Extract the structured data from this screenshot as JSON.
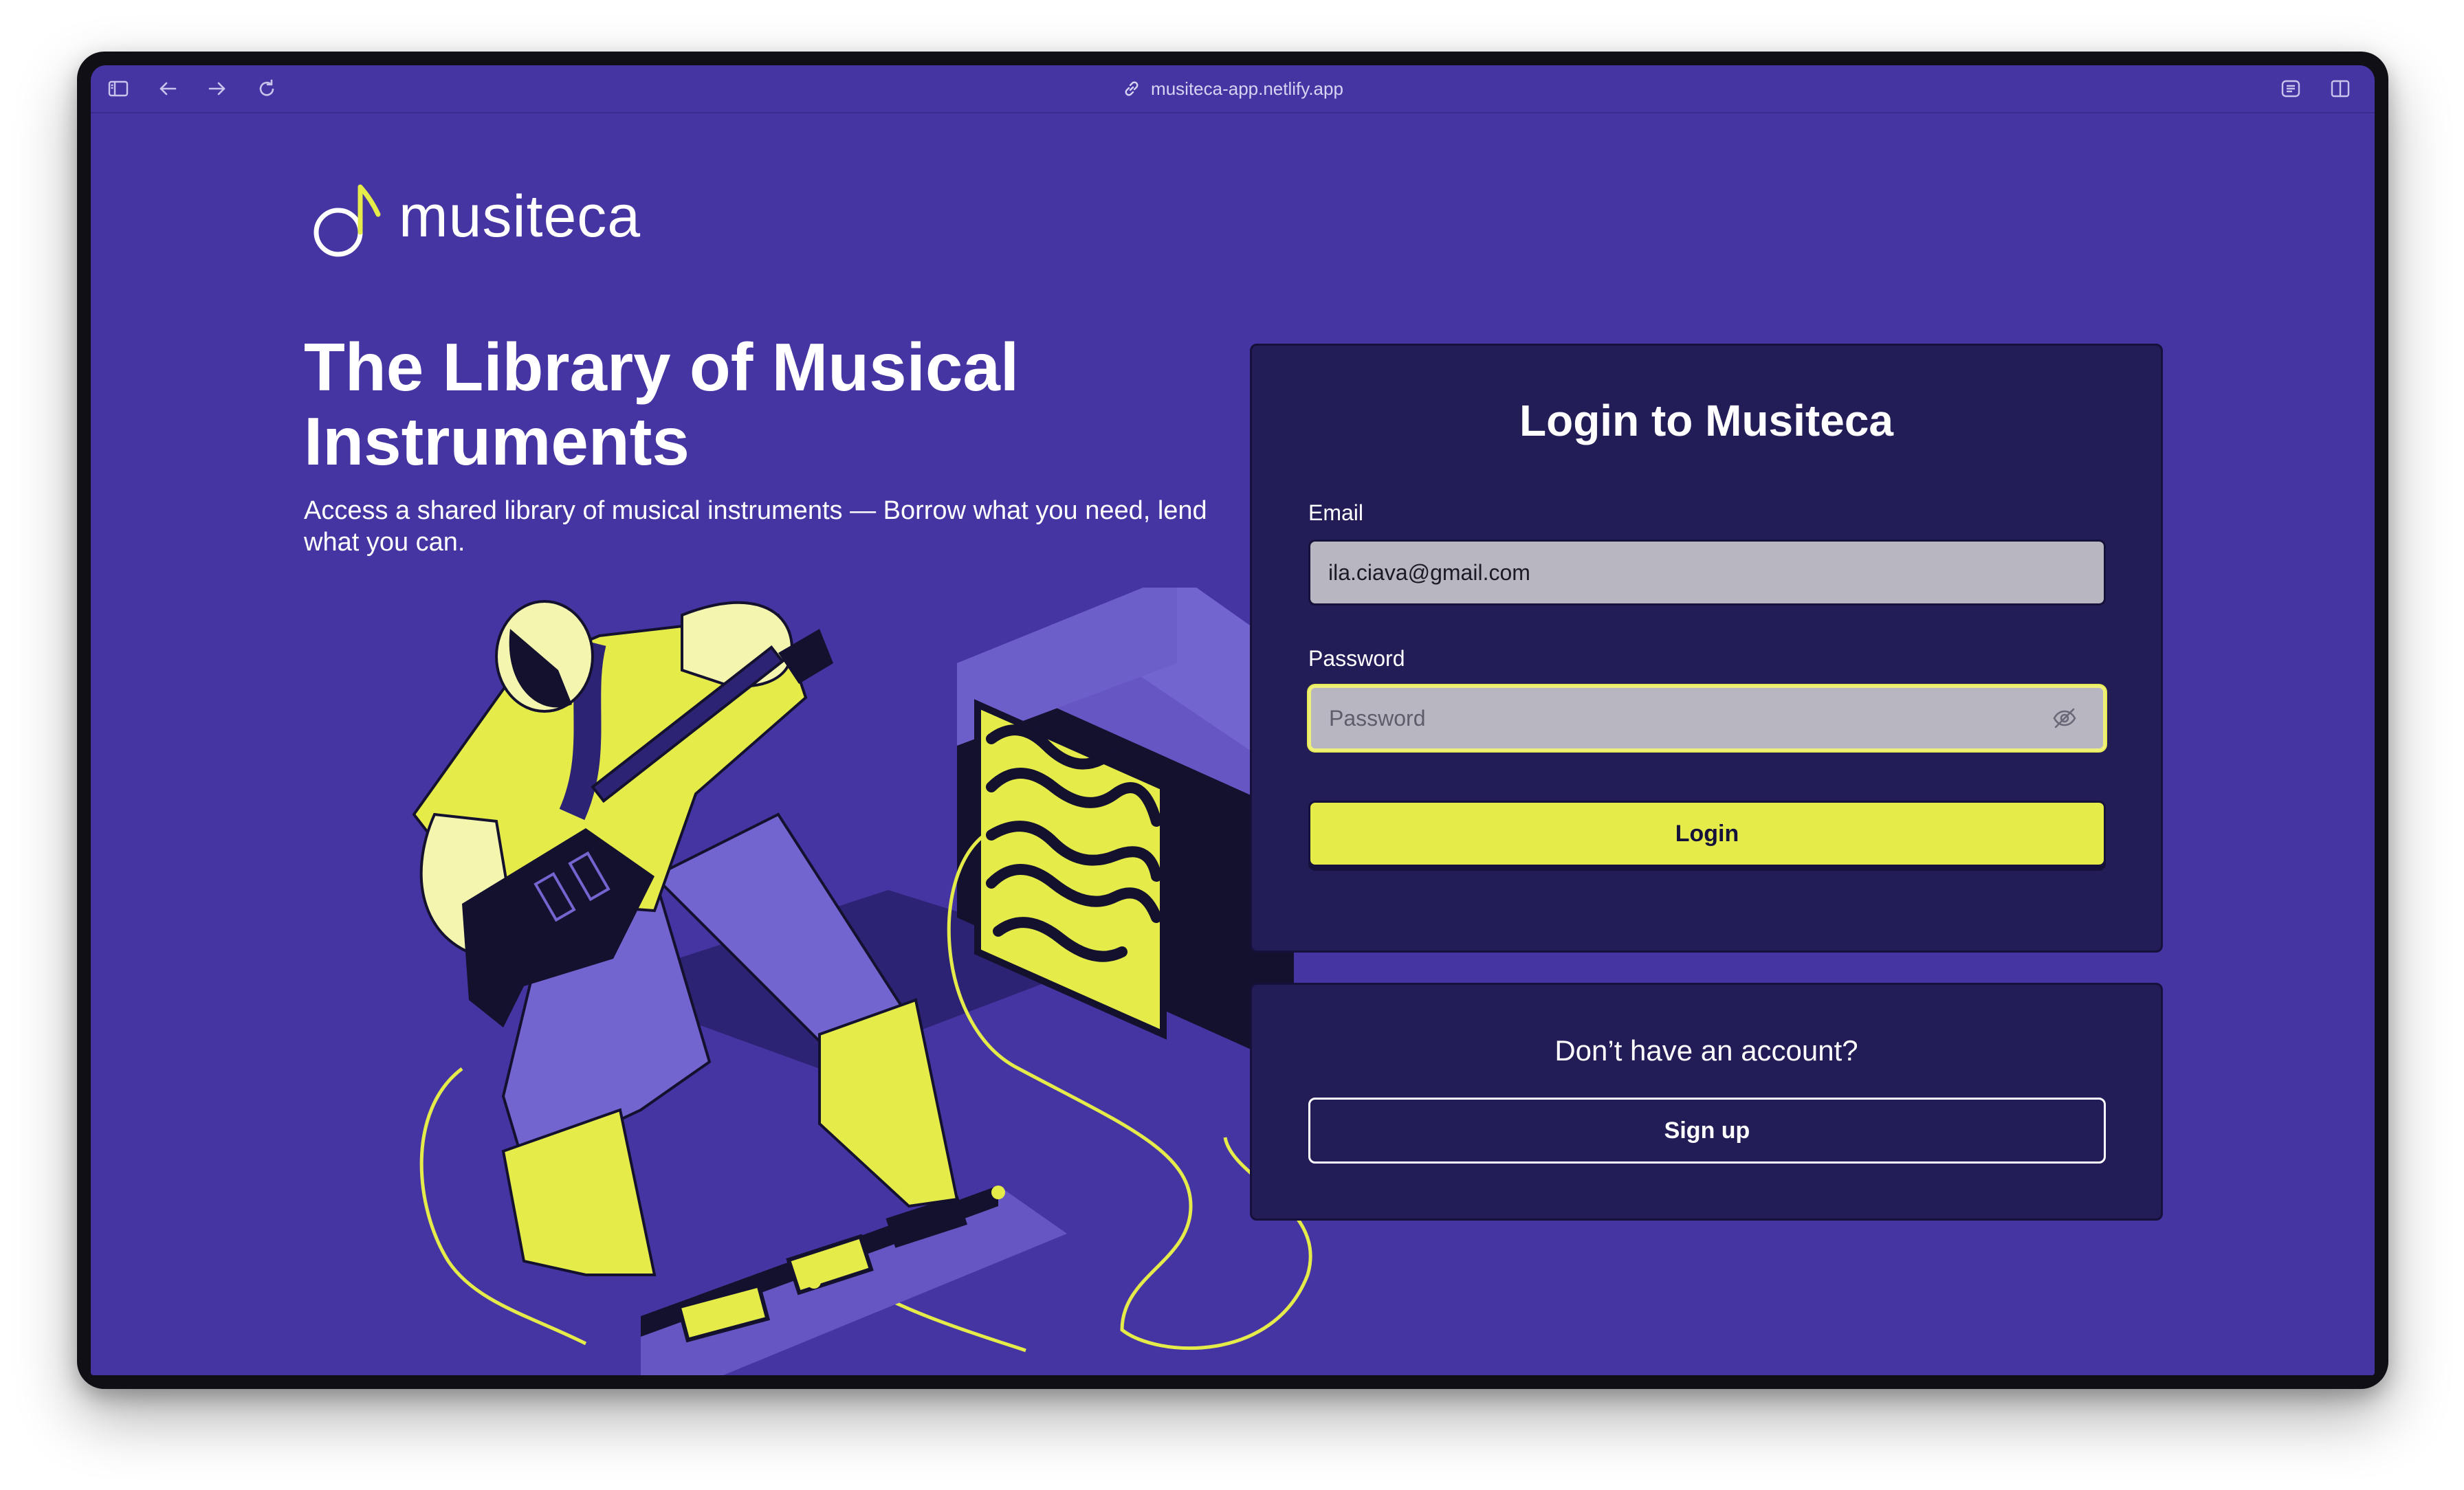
{
  "browser": {
    "url": "musiteca-app.netlify.app"
  },
  "brand": {
    "name": "musiteca",
    "accent": "#e5ec4a",
    "background": "#4535a3",
    "card": "#221c57"
  },
  "hero": {
    "title": "The Library of Musical Instruments",
    "subtitle": "Access a shared library of musical instruments — Borrow what you need, lend what you can."
  },
  "login": {
    "title": "Login to Musiteca",
    "email_label": "Email",
    "email_value": "ila.ciava@gmail.com",
    "password_label": "Password",
    "password_placeholder": "Password",
    "submit_label": "Login"
  },
  "signup": {
    "question": "Don’t have an account?",
    "button_label": "Sign up"
  },
  "icons": [
    "sidebar-icon",
    "back-arrow-icon",
    "forward-arrow-icon",
    "reload-icon",
    "link-icon",
    "reader-icon",
    "split-view-icon",
    "eye-off-icon",
    "music-note-logo"
  ]
}
